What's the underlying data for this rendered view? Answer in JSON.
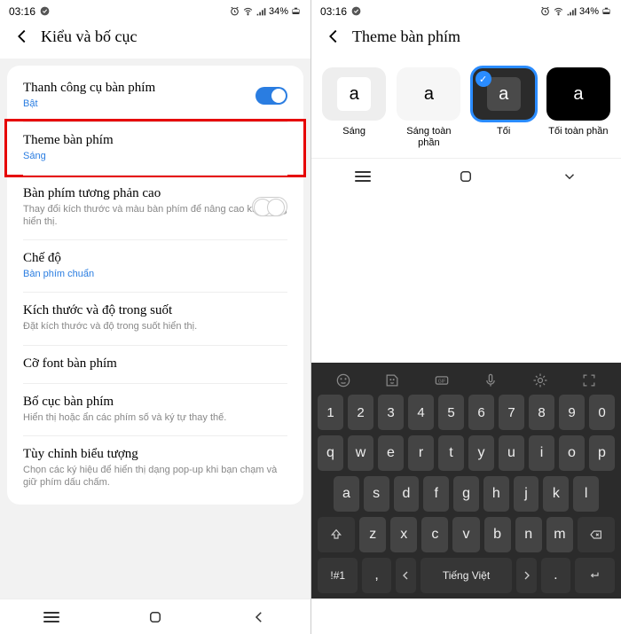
{
  "status": {
    "time": "03:16",
    "battery": "34%"
  },
  "left": {
    "title": "Kiểu và bố cục",
    "rows": {
      "toolbar": {
        "label": "Thanh công cụ bàn phím",
        "sub": "Bật"
      },
      "theme": {
        "label": "Theme bàn phím",
        "sub": "Sáng"
      },
      "contrast": {
        "label": "Bàn phím tương phản cao",
        "sub": "Thay đổi kích thước và màu bàn phím để nâng cao khả năng hiển thị."
      },
      "mode": {
        "label": "Chế độ",
        "sub": "Bàn phím chuẩn"
      },
      "size": {
        "label": "Kích thước và độ trong suốt",
        "sub": "Đặt kích thước và độ trong suốt hiển thị."
      },
      "font": {
        "label": "Cỡ font bàn phím"
      },
      "layout": {
        "label": "Bố cục bàn phím",
        "sub": "Hiển thị hoặc ẩn các phím số và ký tự thay thế."
      },
      "symbols": {
        "label": "Tùy chỉnh biểu tượng",
        "sub": "Chọn các ký hiệu để hiển thị dạng pop-up khi bạn chạm và giữ phím dấu chấm."
      }
    }
  },
  "right": {
    "title": "Theme bàn phím",
    "themes": [
      {
        "label": "Sáng"
      },
      {
        "label": "Sáng toàn phần"
      },
      {
        "label": "Tối"
      },
      {
        "label": "Tối toàn phần"
      }
    ]
  },
  "kbd": {
    "nums": [
      "1",
      "2",
      "3",
      "4",
      "5",
      "6",
      "7",
      "8",
      "9",
      "0"
    ],
    "r1": [
      "q",
      "w",
      "e",
      "r",
      "t",
      "y",
      "u",
      "i",
      "o",
      "p"
    ],
    "r2": [
      "a",
      "s",
      "d",
      "f",
      "g",
      "h",
      "j",
      "k",
      "l"
    ],
    "r3": [
      "z",
      "x",
      "c",
      "v",
      "b",
      "n",
      "m"
    ],
    "sym": "!#1",
    "comma": ",",
    "space": "Tiếng Việt",
    "dot": "."
  }
}
